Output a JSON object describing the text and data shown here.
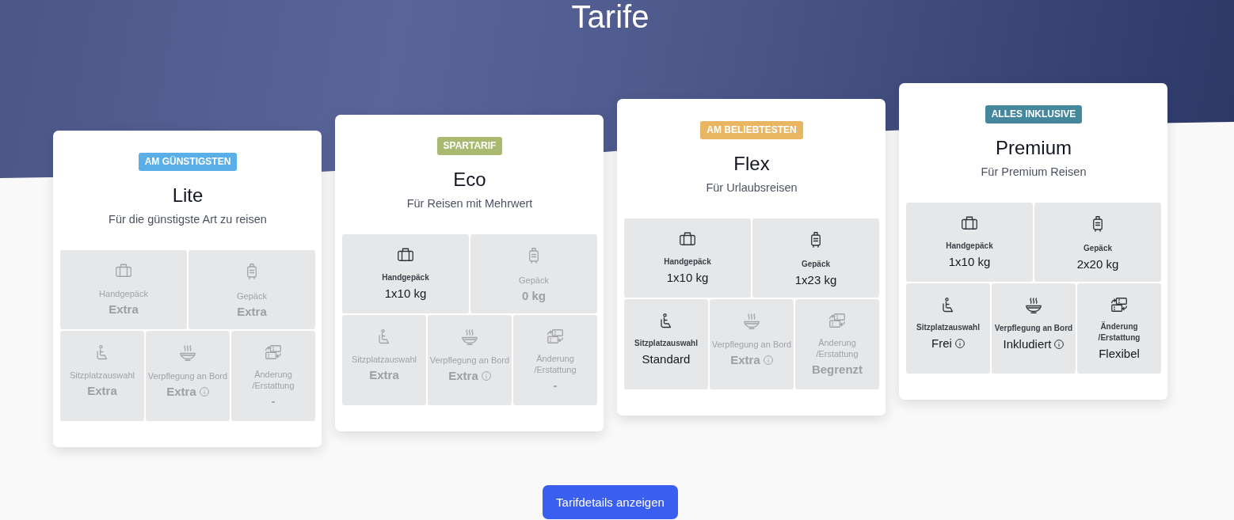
{
  "page": {
    "title": "Tarife"
  },
  "fares": [
    {
      "badge": {
        "text": "AM GÜNSTIGSTEN",
        "color": "#5aafe9"
      },
      "name": "Lite",
      "subtitle": "Für die günstigste Art zu reisen",
      "features": [
        {
          "kind": "cabin_bag",
          "label": "Handgepäck",
          "value": "Extra",
          "included": false,
          "info": false
        },
        {
          "kind": "checked_bag",
          "label": "Gepäck",
          "value": "Extra",
          "included": false,
          "info": false
        },
        {
          "kind": "seat",
          "label": "Sitzplatzauswahl",
          "value": "Extra",
          "included": false,
          "info": false
        },
        {
          "kind": "meal",
          "label": "Verpflegung an Bord",
          "value": "Extra",
          "included": false,
          "info": true
        },
        {
          "kind": "change",
          "label": "Änderung /Erstattung",
          "value": "-",
          "included": false,
          "info": false
        }
      ]
    },
    {
      "badge": {
        "text": "SPARTARIF",
        "color": "#a9b96f"
      },
      "name": "Eco",
      "subtitle": "Für Reisen mit Mehrwert",
      "features": [
        {
          "kind": "cabin_bag",
          "label": "Handgepäck",
          "value": "1x10 kg",
          "included": true,
          "info": false
        },
        {
          "kind": "checked_bag",
          "label": "Gepäck",
          "value": "0 kg",
          "included": false,
          "info": false
        },
        {
          "kind": "seat",
          "label": "Sitzplatzauswahl",
          "value": "Extra",
          "included": false,
          "info": false
        },
        {
          "kind": "meal",
          "label": "Verpflegung an Bord",
          "value": "Extra",
          "included": false,
          "info": true
        },
        {
          "kind": "change",
          "label": "Änderung /Erstattung",
          "value": "-",
          "included": false,
          "info": false
        }
      ]
    },
    {
      "badge": {
        "text": "AM BELIEBTESTEN",
        "color": "#e8b562"
      },
      "name": "Flex",
      "subtitle": "Für Urlaubsreisen",
      "features": [
        {
          "kind": "cabin_bag",
          "label": "Handgepäck",
          "value": "1x10 kg",
          "included": true,
          "info": false
        },
        {
          "kind": "checked_bag",
          "label": "Gepäck",
          "value": "1x23 kg",
          "included": true,
          "info": false
        },
        {
          "kind": "seat",
          "label": "Sitzplatzauswahl",
          "value": "Standard",
          "included": true,
          "info": false
        },
        {
          "kind": "meal",
          "label": "Verpflegung an Bord",
          "value": "Extra",
          "included": false,
          "info": true
        },
        {
          "kind": "change",
          "label": "Änderung /Erstattung",
          "value": "Begrenzt",
          "included": false,
          "info": false
        }
      ]
    },
    {
      "badge": {
        "text": "ALLES INKLUSIVE",
        "color": "#45879c"
      },
      "name": "Premium",
      "subtitle": "Für Premium Reisen",
      "features": [
        {
          "kind": "cabin_bag",
          "label": "Handgepäck",
          "value": "1x10 kg",
          "included": true,
          "info": false
        },
        {
          "kind": "checked_bag",
          "label": "Gepäck",
          "value": "2x20 kg",
          "included": true,
          "info": false
        },
        {
          "kind": "seat",
          "label": "Sitzplatzauswahl",
          "value": "Frei",
          "included": true,
          "info": true
        },
        {
          "kind": "meal",
          "label": "Verpflegung an Bord",
          "value": "Inkludiert",
          "included": true,
          "info": true
        },
        {
          "kind": "change",
          "label": "Änderung /Erstattung",
          "value": "Flexibel",
          "included": true,
          "info": false
        }
      ]
    }
  ],
  "button": {
    "label": "Tarifdetails anzeigen"
  }
}
